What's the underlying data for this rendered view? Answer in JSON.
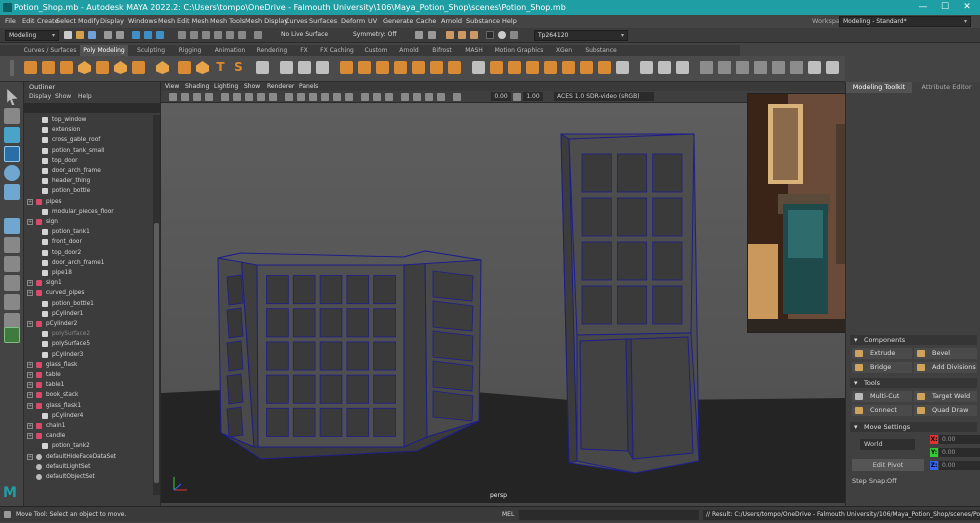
{
  "window": {
    "title": "Potion_Shop.mb - Autodesk MAYA 2022.2: C:\\Users\\tompo\\OneDrive - Falmouth University\\106\\Maya_Potion_Shop\\scenes\\Potion_Shop.mb",
    "min": "—",
    "max": "☐",
    "close": "✕"
  },
  "menubar": {
    "items": [
      "File",
      "Edit",
      "Create",
      "Select",
      "Modify",
      "Display",
      "Windows",
      "Mesh",
      "Edit Mesh",
      "Mesh Tools",
      "Mesh Display",
      "Curves",
      "Surfaces",
      "Deform",
      "UV",
      "Generate",
      "Cache",
      "Arnold",
      "Substance",
      "Help"
    ],
    "workspace_label": "Workspace:",
    "workspace_value": "Modeling - Standard*"
  },
  "statusline": {
    "mode": "Modeling",
    "live": "No Live Surface",
    "symmetry": "Symmetry: Off",
    "user": "Tp264120"
  },
  "shelf_tabs": [
    "Curves / Surfaces",
    "Poly Modeling",
    "Sculpting",
    "Rigging",
    "Animation",
    "Rendering",
    "FX",
    "FX Caching",
    "Custom",
    "Arnold",
    "Bifrost",
    "MASH",
    "Motion Graphics",
    "XGen",
    "Substance"
  ],
  "shelf_active": "Poly Modeling",
  "outliner": {
    "title": "Outliner",
    "menu": [
      "Display",
      "Show",
      "Help"
    ],
    "items": [
      {
        "label": "top_window",
        "indent": 2,
        "icon": "mesh"
      },
      {
        "label": "extension",
        "indent": 2,
        "icon": "mesh"
      },
      {
        "label": "cross_gable_roof",
        "indent": 2,
        "icon": "mesh"
      },
      {
        "label": "potion_tank_small",
        "indent": 2,
        "icon": "mesh"
      },
      {
        "label": "top_door",
        "indent": 2,
        "icon": "mesh"
      },
      {
        "label": "door_arch_frame",
        "indent": 2,
        "icon": "mesh"
      },
      {
        "label": "header_thing",
        "indent": 2,
        "icon": "mesh"
      },
      {
        "label": "potion_bottle",
        "indent": 2,
        "icon": "mesh"
      },
      {
        "label": "pipes",
        "indent": 1,
        "icon": "group",
        "plus": true
      },
      {
        "label": "modular_pieces_floor",
        "indent": 2,
        "icon": "mesh"
      },
      {
        "label": "sign",
        "indent": 1,
        "icon": "group",
        "plus": true
      },
      {
        "label": "potion_tank1",
        "indent": 2,
        "icon": "mesh"
      },
      {
        "label": "front_door",
        "indent": 2,
        "icon": "mesh"
      },
      {
        "label": "top_door2",
        "indent": 2,
        "icon": "mesh"
      },
      {
        "label": "door_arch_frame1",
        "indent": 2,
        "icon": "mesh"
      },
      {
        "label": "pipe18",
        "indent": 2,
        "icon": "mesh"
      },
      {
        "label": "sign1",
        "indent": 1,
        "icon": "group",
        "plus": true
      },
      {
        "label": "curved_pipes",
        "indent": 1,
        "icon": "group",
        "plus": true
      },
      {
        "label": "potion_bottle1",
        "indent": 2,
        "icon": "mesh"
      },
      {
        "label": "pCylinder1",
        "indent": 2,
        "icon": "mesh"
      },
      {
        "label": "pCylinder2",
        "indent": 1,
        "icon": "group",
        "plus": true
      },
      {
        "label": "polySurface2",
        "indent": 2,
        "icon": "mesh",
        "dim": true
      },
      {
        "label": "polySurface5",
        "indent": 2,
        "icon": "mesh"
      },
      {
        "label": "pCylinder3",
        "indent": 2,
        "icon": "mesh"
      },
      {
        "label": "glass_flask",
        "indent": 1,
        "icon": "group",
        "plus": true
      },
      {
        "label": "table",
        "indent": 1,
        "icon": "group",
        "plus": true
      },
      {
        "label": "table1",
        "indent": 1,
        "icon": "group",
        "plus": true
      },
      {
        "label": "book_stack",
        "indent": 1,
        "icon": "group",
        "plus": true
      },
      {
        "label": "glass_flask1",
        "indent": 1,
        "icon": "group",
        "plus": true
      },
      {
        "label": "pCylinder4",
        "indent": 2,
        "icon": "mesh"
      },
      {
        "label": "chain1",
        "indent": 1,
        "icon": "group",
        "plus": true
      },
      {
        "label": "candle",
        "indent": 1,
        "icon": "group",
        "plus": true
      },
      {
        "label": "potion_tank2",
        "indent": 2,
        "icon": "mesh"
      },
      {
        "label": "defaultHideFaceDataSet",
        "indent": 1,
        "icon": "set",
        "plus": true
      },
      {
        "label": "defaultLightSet",
        "indent": 1,
        "icon": "set"
      },
      {
        "label": "defaultObjectSet",
        "indent": 1,
        "icon": "set"
      }
    ]
  },
  "viewport": {
    "menu": [
      "View",
      "Shading",
      "Lighting",
      "Show",
      "Renderer",
      "Panels"
    ],
    "value1": "0.00",
    "value2": "1.00",
    "colorspace": "ACES 1.0 SDR-video (sRGB)",
    "camera": "persp",
    "bg_top": "#5c5c5c",
    "bg_floor": "#232323",
    "wire": "#1e1e8a"
  },
  "right_panel": {
    "tabs": [
      "Modeling Toolkit",
      "Attribute Editor"
    ],
    "components": {
      "title": "Components",
      "buttons": [
        "Extrude",
        "Bevel",
        "Bridge",
        "Add Divisions"
      ]
    },
    "tools": {
      "title": "Tools",
      "buttons": [
        "Multi-Cut",
        "Target Weld",
        "Connect",
        "Quad Draw"
      ]
    },
    "move": {
      "title": "Move Settings",
      "world": "World",
      "x": "X:",
      "y": "Y:",
      "z": "Z:",
      "xv": "0.00",
      "yv": "0.00",
      "zv": "0.00",
      "edit_pivot": "Edit Pivot",
      "step_snap": "Step Snap:",
      "step_value": "Off"
    }
  },
  "statusbar": {
    "help": "Move Tool: Select an object to move.",
    "mel": "MEL",
    "result": "// Result: C:/Users/tompo/OneDrive - Falmouth University/106/Maya_Potion_Shop/scenes/Potion_Shop"
  }
}
